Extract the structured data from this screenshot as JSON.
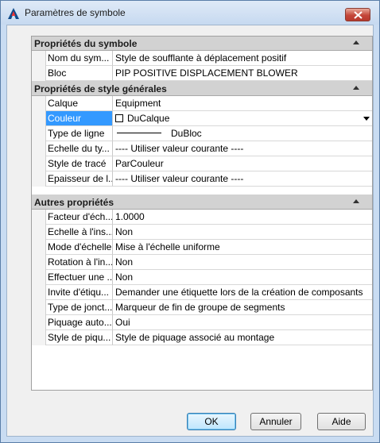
{
  "window": {
    "title": "Paramètres de symbole"
  },
  "sections": {
    "symbol": {
      "title": "Propriétés du symbole",
      "rows": [
        {
          "label": "Nom du sym...",
          "value": "Style de soufflante à déplacement positif"
        },
        {
          "label": "Bloc",
          "value": "PIP POSITIVE DISPLACEMENT BLOWER"
        }
      ]
    },
    "general": {
      "title": "Propriétés de style générales",
      "rows": [
        {
          "label": "Calque",
          "value": "Equipment"
        },
        {
          "label": "Couleur",
          "value": "DuCalque"
        },
        {
          "label": "Type de ligne",
          "value": "DuBloc"
        },
        {
          "label": "Echelle du ty...",
          "value": "---- Utiliser valeur courante ----"
        },
        {
          "label": "Style de tracé",
          "value": "ParCouleur"
        },
        {
          "label": "Epaisseur de l...",
          "value": "---- Utiliser valeur courante ----"
        }
      ]
    },
    "other": {
      "title": "Autres propriétés",
      "rows": [
        {
          "label": "Facteur d'éch...",
          "value": "1.0000"
        },
        {
          "label": "Echelle à l'ins...",
          "value": "Non"
        },
        {
          "label": "Mode d'échelle",
          "value": "Mise à l'échelle uniforme"
        },
        {
          "label": "Rotation à l'in...",
          "value": "Non"
        },
        {
          "label": "Effectuer une ...",
          "value": "Non"
        },
        {
          "label": "Invite d'étiqu...",
          "value": "Demander une étiquette lors de la création de composants"
        },
        {
          "label": "Type de jonct...",
          "value": "Marqueur de fin de groupe de segments"
        },
        {
          "label": "Piquage auto...",
          "value": "Oui"
        },
        {
          "label": "Style de piqu...",
          "value": "Style de piquage associé au montage"
        }
      ]
    }
  },
  "buttons": {
    "ok": "OK",
    "cancel": "Annuler",
    "help": "Aide"
  },
  "colors": {
    "selection": "#3399ff",
    "section_header": "#d2d2d2",
    "client_bg": "#f0f0f0"
  },
  "icons": {
    "app": "autocad-logo-icon",
    "close": "close-icon",
    "collapse": "collapse-triangle-icon",
    "dropdown": "chevron-down-icon"
  }
}
